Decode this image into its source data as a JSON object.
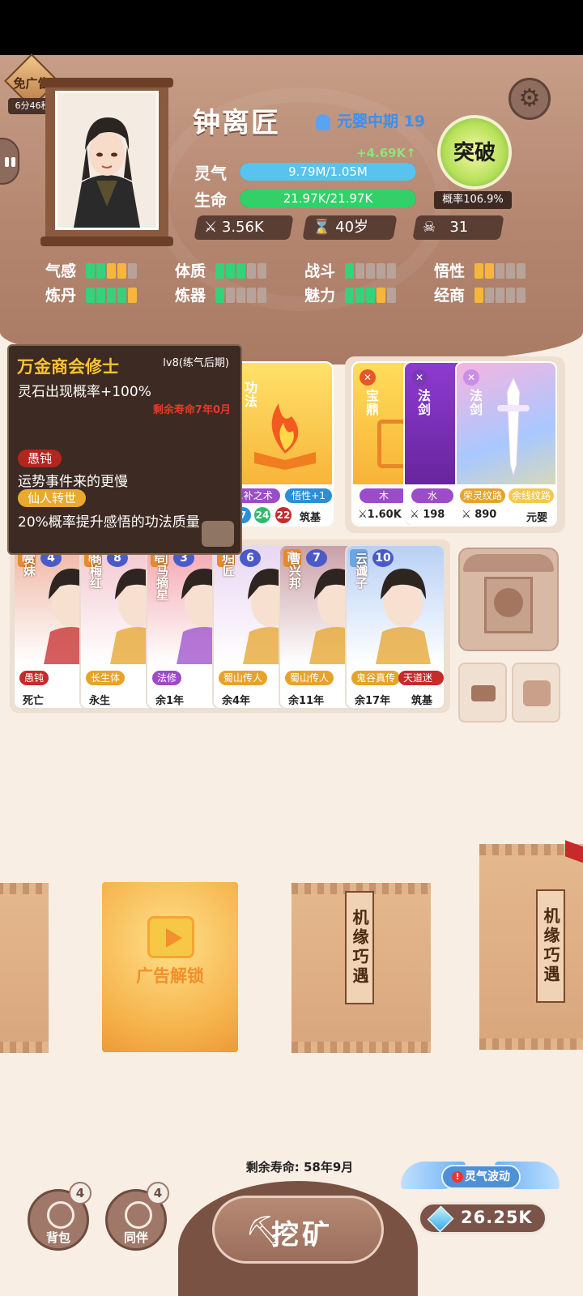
{
  "ad_free": {
    "label": "免广告",
    "timer": "6分46秒"
  },
  "hero": {
    "name": "钟离匠",
    "realm": "元婴中期 19"
  },
  "qi": {
    "label": "灵气",
    "value": "9.79M/1.05M",
    "gain": "+4.69K↑",
    "fill": 1.0
  },
  "life": {
    "label": "生命",
    "value": "21.97K/21.97K",
    "fill": 1.0
  },
  "mini_stats": {
    "power": "3.56K",
    "age": "40岁",
    "kills": "31"
  },
  "breakthrough": {
    "label": "突破",
    "prob": "概率106.9%"
  },
  "attributes": [
    {
      "label": "气感",
      "pips": [
        "g",
        "g",
        "y",
        "y",
        "n"
      ]
    },
    {
      "label": "体质",
      "pips": [
        "g",
        "g",
        "g",
        "n",
        "n"
      ]
    },
    {
      "label": "战斗",
      "pips": [
        "g",
        "n",
        "n",
        "n",
        "n"
      ]
    },
    {
      "label": "悟性",
      "pips": [
        "y",
        "y",
        "n",
        "n",
        "n"
      ]
    },
    {
      "label": "炼丹",
      "pips": [
        "g",
        "g",
        "g",
        "g",
        "y"
      ]
    },
    {
      "label": "炼器",
      "pips": [
        "g",
        "n",
        "n",
        "n",
        "n"
      ]
    },
    {
      "label": "魅力",
      "pips": [
        "g",
        "g",
        "g",
        "y",
        "n"
      ]
    },
    {
      "label": "经商",
      "pips": [
        "y",
        "n",
        "n",
        "n",
        "n"
      ]
    }
  ],
  "tooltip": {
    "title": "万金商会修士",
    "level": "lv8(练气后期)",
    "effect": "灵石出现概率+100%",
    "remaining": "剩余寿命7年0月",
    "trait1": "愚钝",
    "trait1_desc": "运势事件来的更慢",
    "trait2": "仙人转世",
    "trait2_desc": "20%概率提升感悟的功法质量"
  },
  "skill_card": {
    "name": "功法",
    "pill1": "...补之术",
    "pill2": "悟性+1",
    "n1": "7",
    "n2": "24",
    "n3": "22",
    "rank": "筑基"
  },
  "items": [
    {
      "name": "宝鼎",
      "element": "木",
      "power": "1.60K"
    },
    {
      "name": "法剑",
      "element": "水",
      "power": "198"
    },
    {
      "name": "法剑",
      "element": "荣灵纹路",
      "element2": "余线纹路",
      "power": "890",
      "rank": "元婴"
    }
  ],
  "companions": [
    {
      "badge": "商",
      "level": "4",
      "name": "赏妹",
      "trait": "愚钝",
      "trait2": "仙",
      "life": "死亡",
      "color": "#c62a2a"
    },
    {
      "badge": "商",
      "level": "8",
      "name": "商梅红",
      "trait": "长生体",
      "life": "永生",
      "color": "#e6a32a"
    },
    {
      "badge": "药",
      "level": "3",
      "name": "司马摘星",
      "trait": "法修",
      "life": "余1年",
      "color": "#9b4cc9"
    },
    {
      "badge": "玄",
      "level": "6",
      "name": "归匠",
      "trait": "蜀山传人",
      "life": "余4年",
      "color": "#e6a32a"
    },
    {
      "badge": "商",
      "level": "7",
      "name": "曹兴邦",
      "trait": "蜀山传人",
      "trait2": "世",
      "life": "余11年",
      "color": "#e6a32a"
    },
    {
      "badge": "",
      "level": "10",
      "name": "云谶子",
      "trait": "鬼谷真传",
      "trait3": "天道迷惘",
      "life": "余17年",
      "rank": "筑基",
      "color": "#e6a32a"
    }
  ],
  "packs": {
    "seal": "机缘巧遇",
    "ad_unlock": "广告解锁"
  },
  "bottom": {
    "remaining_life": "剩余寿命: 58年9月",
    "bag": {
      "label": "背包",
      "count": "4"
    },
    "partner": {
      "label": "同伴",
      "count": "4"
    },
    "mine": "挖矿",
    "wave": "灵气波动",
    "gems": "26.25K"
  },
  "colors": {
    "accent": "#f7c233",
    "qi_bar": "#57c3ee",
    "life_bar": "#33d06a",
    "panel": "#b48670"
  }
}
